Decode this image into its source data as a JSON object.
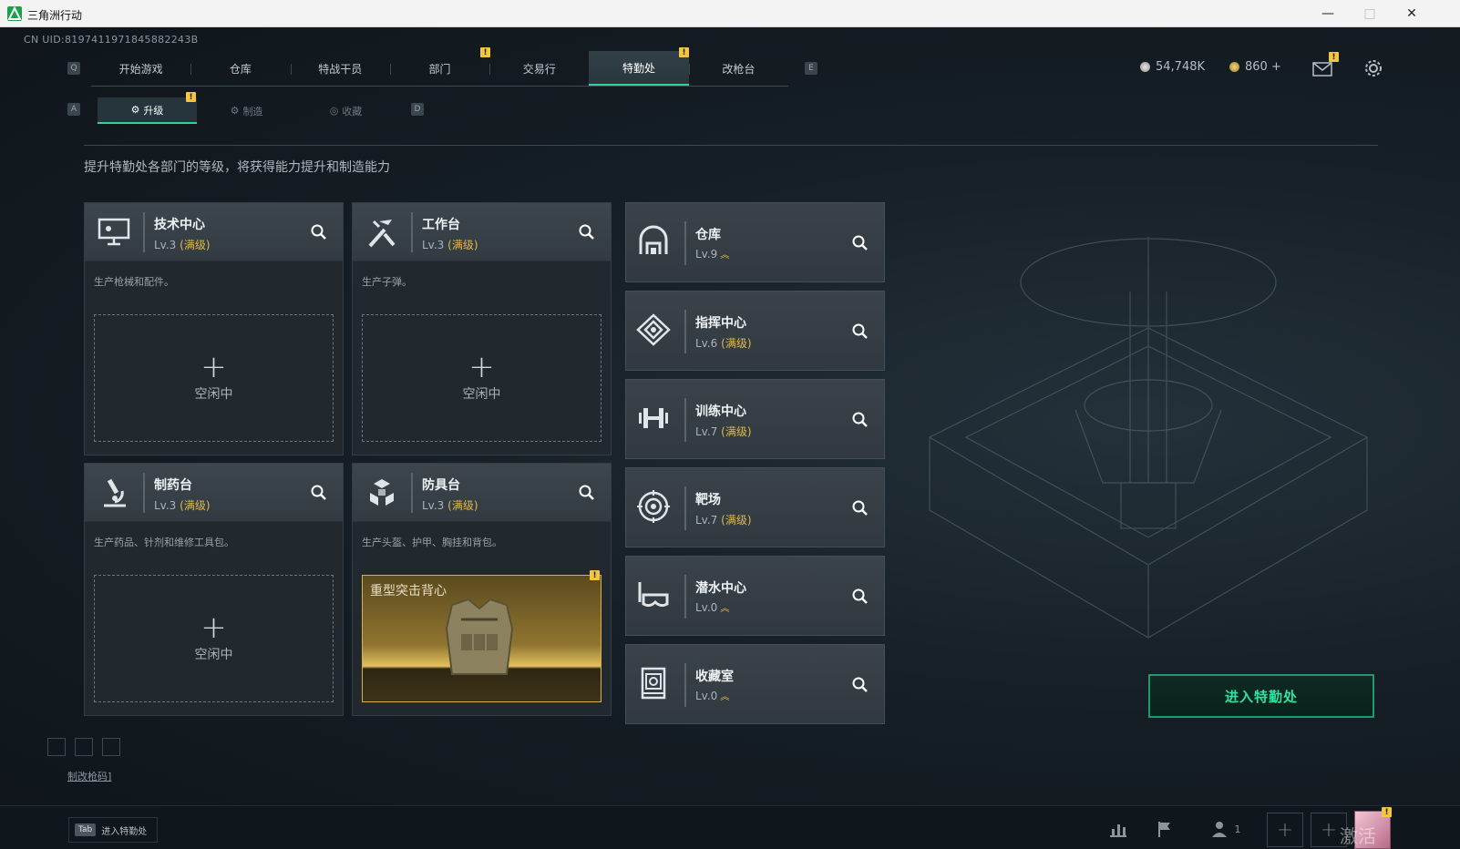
{
  "window": {
    "title": "三角洲行动"
  },
  "uid": "CN UID:8197411971845882243B",
  "hotkeys": {
    "q": "Q",
    "e": "E",
    "a": "A",
    "d": "D"
  },
  "main_tabs": [
    {
      "label": "开始游戏",
      "active": false
    },
    {
      "label": "仓库",
      "active": false
    },
    {
      "label": "特战干员",
      "active": false
    },
    {
      "label": "部门",
      "active": false,
      "badge": "!"
    },
    {
      "label": "交易行",
      "active": false
    },
    {
      "label": "特勤处",
      "active": true,
      "badge": "!"
    },
    {
      "label": "改枪台",
      "active": false
    }
  ],
  "currency": {
    "coins": "54,748K",
    "tickets": "860 +"
  },
  "mail_badge": "!",
  "sub_tabs": [
    {
      "label": "升级",
      "active": true,
      "badge": "!"
    },
    {
      "label": "制造",
      "active": false
    },
    {
      "label": "收藏",
      "active": false
    }
  ],
  "description": "提升特勤处各部门的等级，将获得能力提升和制造能力",
  "workbenches": [
    {
      "name": "技术中心",
      "level": "Lv.3",
      "max_label": "(满级)",
      "desc": "生产枪械和配件。",
      "slot_label": "空闲中",
      "icon": "computer-icon"
    },
    {
      "name": "工作台",
      "level": "Lv.3",
      "max_label": "(满级)",
      "desc": "生产子弹。",
      "slot_label": "空闲中",
      "icon": "tools-icon"
    },
    {
      "name": "制药台",
      "level": "Lv.3",
      "max_label": "(满级)",
      "desc": "生产药品、针剂和维修工具包。",
      "slot_label": "空闲中",
      "icon": "microscope-icon"
    },
    {
      "name": "防具台",
      "level": "Lv.3",
      "max_label": "(满级)",
      "desc": "生产头盔、护甲、胸挂和背包。",
      "craft_item": "重型突击背心",
      "craft_badge": "!",
      "icon": "armor-icon"
    }
  ],
  "facilities": [
    {
      "name": "仓库",
      "level": "Lv.9",
      "max_label": "",
      "upgradable": true,
      "icon": "warehouse-icon"
    },
    {
      "name": "指挥中心",
      "level": "Lv.6",
      "max_label": "(满级)",
      "upgradable": false,
      "icon": "command-icon"
    },
    {
      "name": "训练中心",
      "level": "Lv.7",
      "max_label": "(满级)",
      "upgradable": false,
      "icon": "dumbbell-icon"
    },
    {
      "name": "靶场",
      "level": "Lv.7",
      "max_label": "(满级)",
      "upgradable": false,
      "icon": "target-icon"
    },
    {
      "name": "潜水中心",
      "level": "Lv.0",
      "max_label": "",
      "upgradable": true,
      "icon": "diving-mask-icon"
    },
    {
      "name": "收藏室",
      "level": "Lv.0",
      "max_label": "",
      "upgradable": true,
      "icon": "collection-icon"
    }
  ],
  "enter_button": "进入特勤处",
  "bottom": {
    "link": "制改枪码]",
    "tab_key": "Tab",
    "tab_hint": "进入特勤处",
    "friends_count": "1",
    "watermark": "激活 Windows"
  },
  "colors": {
    "accent": "#2fd39a",
    "max_level": "#e2b94a",
    "badge": "#f5c542"
  }
}
